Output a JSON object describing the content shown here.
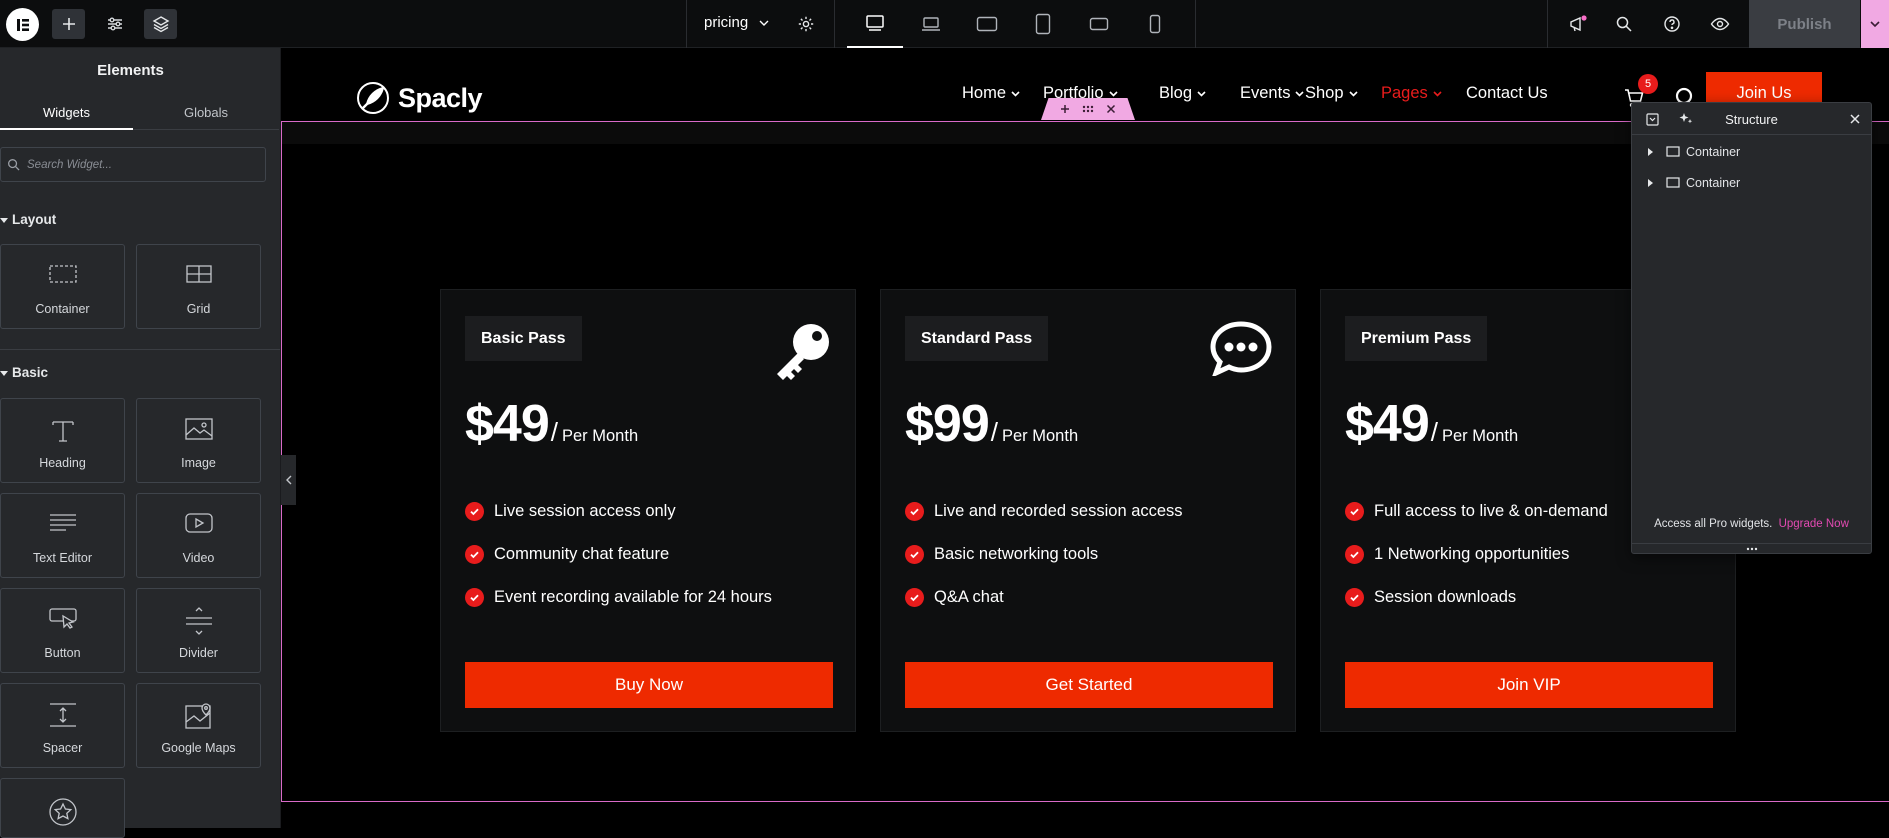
{
  "topbar": {
    "page_name": "pricing",
    "publish_label": "Publish"
  },
  "sidebar": {
    "title": "Elements",
    "tabs": [
      "Widgets",
      "Globals"
    ],
    "search_placeholder": "Search Widget...",
    "categories": {
      "layout": "Layout",
      "basic": "Basic"
    },
    "widgets": {
      "container": "Container",
      "grid": "Grid",
      "heading": "Heading",
      "image": "Image",
      "text_editor": "Text Editor",
      "video": "Video",
      "button": "Button",
      "divider": "Divider",
      "spacer": "Spacer",
      "google_maps": "Google Maps"
    }
  },
  "site": {
    "logo_text": "Spacly",
    "nav": [
      "Home",
      "Portfolio",
      "Blog",
      "Events",
      "Shop",
      "Pages",
      "Contact Us"
    ],
    "cart_count": "5",
    "join_label": "Join Us",
    "accent": "#ee2a00"
  },
  "cards": [
    {
      "title": "Basic Pass",
      "price": "$49",
      "slash": "/",
      "period": "Per Month",
      "icon": "key-icon",
      "features": [
        "Live session access only",
        "Community chat feature",
        "Event recording available for 24 hours"
      ],
      "cta": "Buy Now"
    },
    {
      "title": "Standard Pass",
      "price": "$99",
      "slash": "/",
      "period": "Per Month",
      "icon": "chat-bubble-icon",
      "features": [
        "Live and recorded session access",
        "Basic networking tools",
        "Q&A chat"
      ],
      "cta": "Get Started"
    },
    {
      "title": "Premium Pass",
      "price": "$49",
      "slash": "/",
      "period": "Per Month",
      "icon": "",
      "features": [
        "Full access to live & on-demand",
        "1 Networking opportunities",
        "Session downloads"
      ],
      "cta": "Join VIP"
    }
  ],
  "structure": {
    "title": "Structure",
    "items": [
      "Container",
      "Container"
    ],
    "promo_text": "Access all Pro widgets.",
    "upgrade_label": "Upgrade Now"
  }
}
